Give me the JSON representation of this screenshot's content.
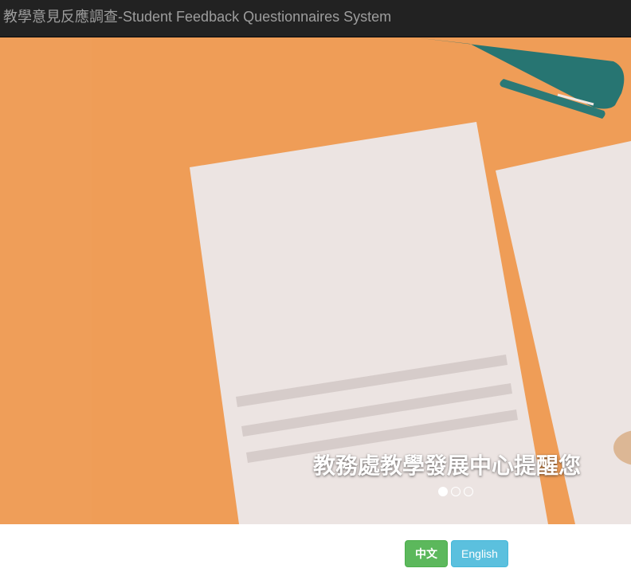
{
  "navbar": {
    "brand": "教學意見反應調查-Student Feedback Questionnaires System"
  },
  "carousel": {
    "caption": "教務處教學發展中心提醒您",
    "active_slide": 1,
    "slide_count": 3,
    "background_color": "#ef9d57"
  },
  "language": {
    "chinese_label": "中文",
    "english_label": "English"
  },
  "colors": {
    "navbar_bg": "#222222",
    "brand_text": "#9d9d9d",
    "success": "#5cb85c",
    "info": "#5bc0de"
  }
}
